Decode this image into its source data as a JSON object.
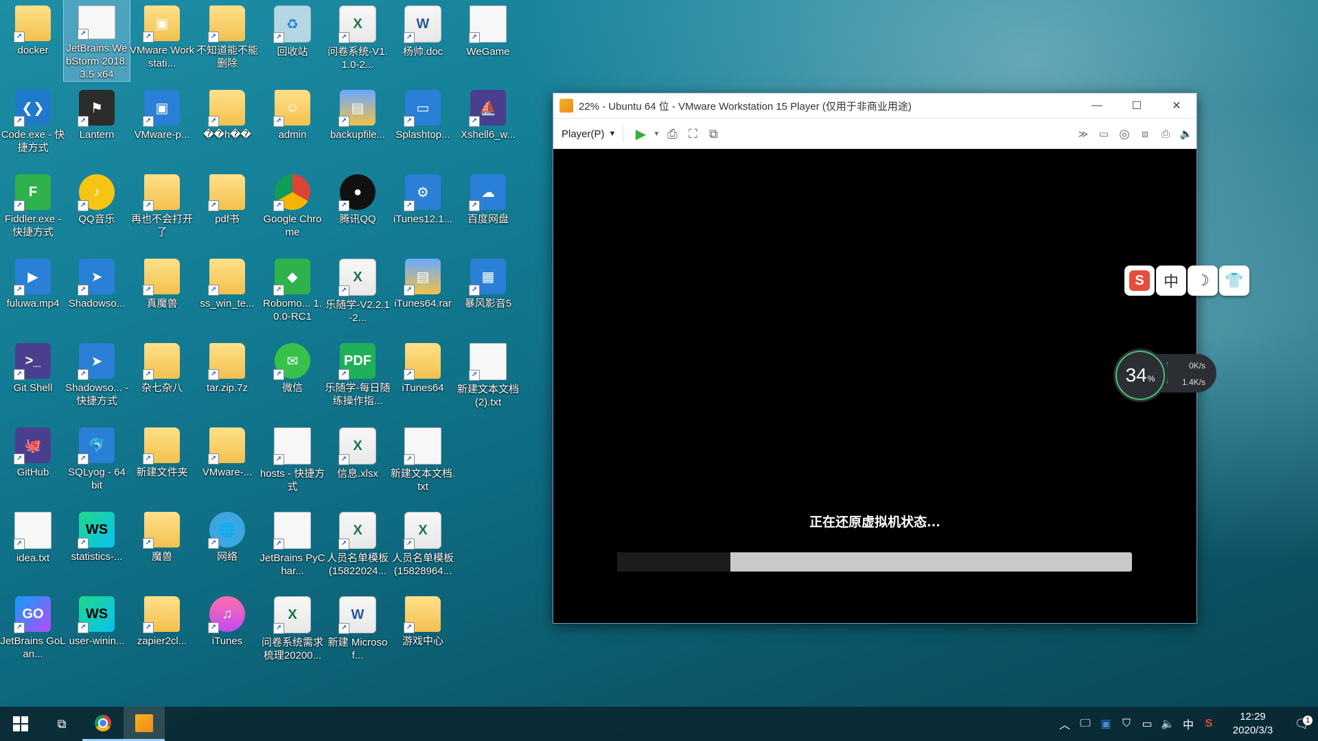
{
  "desktop": {
    "icons": [
      {
        "label": "docker",
        "icon": "folder-icon"
      },
      {
        "label": "JetBrains WebStorm 2018.3.5 x64",
        "icon": "file-icon"
      },
      {
        "label": "VMware Workstati...",
        "icon": "vmware-icon"
      },
      {
        "label": "不知道能不能删除",
        "icon": "folder-icon"
      },
      {
        "label": "回收站",
        "icon": "recycle-bin-icon"
      },
      {
        "label": "问卷系统-V1.1.0-2...",
        "icon": "excel-icon"
      },
      {
        "label": "杨帅.doc",
        "icon": "word-icon"
      },
      {
        "label": "WeGame",
        "icon": "file-icon"
      },
      {
        "label": "Code.exe - 快捷方式",
        "icon": "vscode-icon"
      },
      {
        "label": "Lantern",
        "icon": "lantern-icon"
      },
      {
        "label": "VMware-p...",
        "icon": "vmware-player-icon"
      },
      {
        "label": "��h��",
        "icon": "folder-icon"
      },
      {
        "label": "admin",
        "icon": "user-folder-icon"
      },
      {
        "label": "backupfile...",
        "icon": "archive-icon"
      },
      {
        "label": "Splashtop...",
        "icon": "splashtop-icon"
      },
      {
        "label": "Xshell6_w...",
        "icon": "xshell-icon"
      },
      {
        "label": "Fiddler.exe - 快捷方式",
        "icon": "fiddler-icon"
      },
      {
        "label": "QQ音乐",
        "icon": "qq-music-icon"
      },
      {
        "label": "再也不会打开了",
        "icon": "folder-icon"
      },
      {
        "label": "pdf书",
        "icon": "folder-icon"
      },
      {
        "label": "Google Chrome",
        "icon": "chrome-icon"
      },
      {
        "label": "腾讯QQ",
        "icon": "qq-icon"
      },
      {
        "label": "iTunes12.1...",
        "icon": "installer-icon"
      },
      {
        "label": "百度网盘",
        "icon": "baidu-netdisk-icon"
      },
      {
        "label": "fuluwa.mp4",
        "icon": "video-icon"
      },
      {
        "label": "Shadowso...",
        "icon": "shadowsocks-icon"
      },
      {
        "label": "真魔兽",
        "icon": "folder-icon"
      },
      {
        "label": "ss_win_te...",
        "icon": "folder-icon"
      },
      {
        "label": "Robomo... 1.0.0-RC1",
        "icon": "robomongo-icon"
      },
      {
        "label": "乐随学-V2.2.1-2...",
        "icon": "excel-icon"
      },
      {
        "label": "iTunes64.rar",
        "icon": "archive-icon"
      },
      {
        "label": "暴风影音5",
        "icon": "storm-player-icon"
      },
      {
        "label": "Git Shell",
        "icon": "terminal-icon"
      },
      {
        "label": "Shadowso... - 快捷方式",
        "icon": "shadowsocks-icon"
      },
      {
        "label": "杂七杂八",
        "icon": "folder-icon"
      },
      {
        "label": "tar.zip.7z",
        "icon": "folder-icon"
      },
      {
        "label": "微信",
        "icon": "wechat-icon"
      },
      {
        "label": "乐随学-每日随练操作指...",
        "icon": "pdf-icon"
      },
      {
        "label": "iTunes64",
        "icon": "folder-icon"
      },
      {
        "label": "新建文本文档(2).txt",
        "icon": "text-file-icon"
      },
      {
        "label": "GitHub",
        "icon": "github-icon"
      },
      {
        "label": "SQLyog - 64 bit",
        "icon": "sqlyog-icon"
      },
      {
        "label": "新建文件夹",
        "icon": "folder-icon"
      },
      {
        "label": "VMware-...",
        "icon": "folder-icon"
      },
      {
        "label": "hosts - 快捷方式",
        "icon": "file-icon"
      },
      {
        "label": "信息.xlsx",
        "icon": "excel-icon"
      },
      {
        "label": "新建文本文档.txt",
        "icon": "text-file-icon"
      },
      {
        "label": "idea.txt",
        "icon": "text-file-icon"
      },
      {
        "label": "statistics-...",
        "icon": "webstorm-icon"
      },
      {
        "label": "魔兽",
        "icon": "folder-icon"
      },
      {
        "label": "网络",
        "icon": "network-icon"
      },
      {
        "label": "JetBrains PyChar...",
        "icon": "file-icon"
      },
      {
        "label": "人员名单模板(15822024...",
        "icon": "excel-icon"
      },
      {
        "label": "人员名单模板(15828964...",
        "icon": "excel-icon"
      },
      {
        "label": "JetBrains GoLan...",
        "icon": "goland-icon"
      },
      {
        "label": "user-winin...",
        "icon": "webstorm-icon"
      },
      {
        "label": "zapier2cl...",
        "icon": "folder-icon"
      },
      {
        "label": "iTunes",
        "icon": "itunes-icon"
      },
      {
        "label": "问卷系统需求梳理20200...",
        "icon": "excel-icon"
      },
      {
        "label": "新建 Microsof...",
        "icon": "word-icon"
      },
      {
        "label": "游戏中心",
        "icon": "folder-icon"
      }
    ]
  },
  "vmware": {
    "title": "22% - Ubuntu 64 位 - VMware Workstation 15 Player (仅用于非商业用途)",
    "player_menu": "Player(P)",
    "restore_text": "正在还原虚拟机状态...",
    "progress_fraction": 0.22
  },
  "ime": {
    "sogou_label": "S",
    "mode_label": "中",
    "moon_label": "☽",
    "skin_label": "👕"
  },
  "net_widget": {
    "percent": "34",
    "percent_unit": "%",
    "upload": "0K/s",
    "download": "1.4K/s"
  },
  "taskbar": {
    "tray_lang": "中",
    "time": "12:29",
    "date": "2020/3/3",
    "notifications": "1"
  }
}
